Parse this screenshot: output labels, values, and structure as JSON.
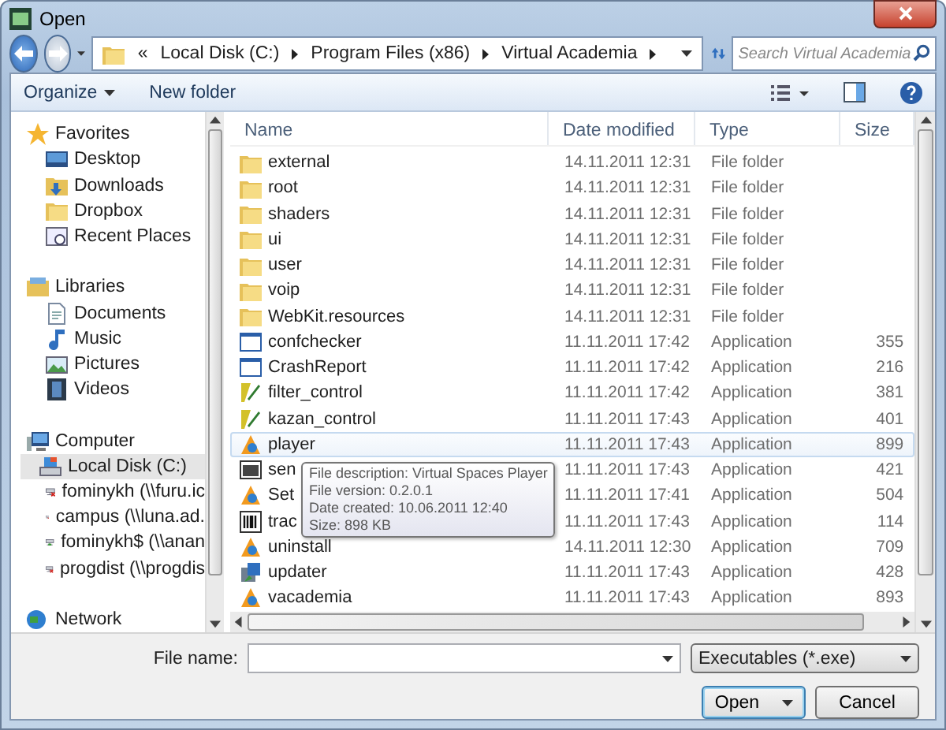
{
  "window": {
    "title": "Open"
  },
  "address": {
    "crumbs": [
      "«",
      "Local Disk (C:)",
      "Program Files (x86)",
      "Virtual Academia"
    ]
  },
  "search": {
    "placeholder": "Search Virtual Academia"
  },
  "toolbar": {
    "buttons": [
      "Organize",
      "New folder"
    ]
  },
  "sidebar": {
    "groups": [
      {
        "label": "Favorites",
        "kind": "star",
        "items": [
          {
            "label": "Desktop",
            "kind": "desktop",
            "selected": false
          },
          {
            "label": "Downloads",
            "kind": "downloads",
            "selected": false
          },
          {
            "label": "Dropbox",
            "kind": "folder",
            "selected": false
          },
          {
            "label": "Recent Places",
            "kind": "recent",
            "selected": false
          }
        ]
      },
      {
        "label": "Libraries",
        "kind": "library",
        "items": [
          {
            "label": "Documents",
            "kind": "document",
            "selected": false
          },
          {
            "label": "Music",
            "kind": "music",
            "selected": false
          },
          {
            "label": "Pictures",
            "kind": "pictures",
            "selected": false
          },
          {
            "label": "Videos",
            "kind": "video",
            "selected": false
          }
        ]
      },
      {
        "label": "Computer",
        "kind": "computer",
        "items": [
          {
            "label": "Local Disk (C:)",
            "kind": "disk",
            "selected": true
          },
          {
            "label": "fominykh (\\\\furu.ic",
            "kind": "netdrive",
            "disconnected": true,
            "selected": false
          },
          {
            "label": "campus (\\\\luna.ad.",
            "kind": "netdrive",
            "disconnected": true,
            "selected": false
          },
          {
            "label": "fominykh$ (\\\\anan",
            "kind": "netdrive",
            "disconnected": false,
            "selected": false
          },
          {
            "label": "progdist (\\\\progdis",
            "kind": "netdrive",
            "disconnected": true,
            "selected": false
          }
        ]
      },
      {
        "label": "Network",
        "kind": "network"
      }
    ]
  },
  "table": {
    "columns": [
      "Name",
      "Date modified",
      "Type",
      "Size"
    ],
    "rows": [
      {
        "name": "external",
        "kind": "folder",
        "date": "14.11.2011 12:31",
        "type": "File folder",
        "selected": false
      },
      {
        "name": "root",
        "kind": "folder",
        "date": "14.11.2011 12:31",
        "type": "File folder",
        "selected": false
      },
      {
        "name": "shaders",
        "kind": "folder",
        "date": "14.11.2011 12:31",
        "type": "File folder",
        "selected": false
      },
      {
        "name": "ui",
        "kind": "folder",
        "date": "14.11.2011 12:31",
        "type": "File folder",
        "selected": false
      },
      {
        "name": "user",
        "kind": "folder",
        "date": "14.11.2011 12:31",
        "type": "File folder",
        "selected": false
      },
      {
        "name": "voip",
        "kind": "folder",
        "date": "14.11.2011 12:31",
        "type": "File folder",
        "selected": false
      },
      {
        "name": "WebKit.resources",
        "kind": "folder",
        "date": "14.11.2011 12:31",
        "type": "File folder",
        "selected": false
      },
      {
        "name": "confchecker",
        "kind": "window",
        "date": "11.11.2011 17:42",
        "type": "Application",
        "size": "355",
        "selected": false
      },
      {
        "name": "CrashReport",
        "kind": "window",
        "date": "11.11.2011 17:42",
        "type": "Application",
        "size": "216",
        "selected": false
      },
      {
        "name": "filter_control",
        "kind": "tool",
        "date": "11.11.2011 17:42",
        "type": "Application",
        "size": "381",
        "selected": false
      },
      {
        "name": "kazan_control",
        "kind": "tool",
        "date": "11.11.2011 17:43",
        "type": "Application",
        "size": "401",
        "selected": false
      },
      {
        "name": "player",
        "kind": "academia",
        "date": "11.11.2011 17:43",
        "type": "Application",
        "size": "899",
        "selected": true
      },
      {
        "name": "sen",
        "kind": "terminal",
        "date": "11.11.2011 17:43",
        "type": "Application",
        "size": "421",
        "selected": false
      },
      {
        "name": "Set",
        "kind": "academia",
        "date": "11.11.2011 17:41",
        "type": "Application",
        "size": "504",
        "selected": false
      },
      {
        "name": "trac",
        "kind": "barcode",
        "date": "11.11.2011 17:43",
        "type": "Application",
        "size": "114",
        "selected": false
      },
      {
        "name": "uninstall",
        "kind": "academia",
        "date": "14.11.2011 12:30",
        "type": "Application",
        "size": "709",
        "selected": false
      },
      {
        "name": "updater",
        "kind": "installer",
        "date": "11.11.2011 17:43",
        "type": "Application",
        "size": "428",
        "selected": false
      },
      {
        "name": "vacademia",
        "kind": "academia",
        "date": "11.11.2011 17:43",
        "type": "Application",
        "size": "893",
        "selected": false
      }
    ]
  },
  "tooltip": {
    "lines": [
      "File description: Virtual Spaces Player",
      "File version: 0.2.0.1",
      "Date created: 10.06.2011 12:40",
      "Size: 898 KB"
    ]
  },
  "file_name": {
    "label": "File name:"
  },
  "filter": {
    "value": "Executables (*.exe)"
  },
  "buttons": [
    "Open",
    "Cancel"
  ]
}
